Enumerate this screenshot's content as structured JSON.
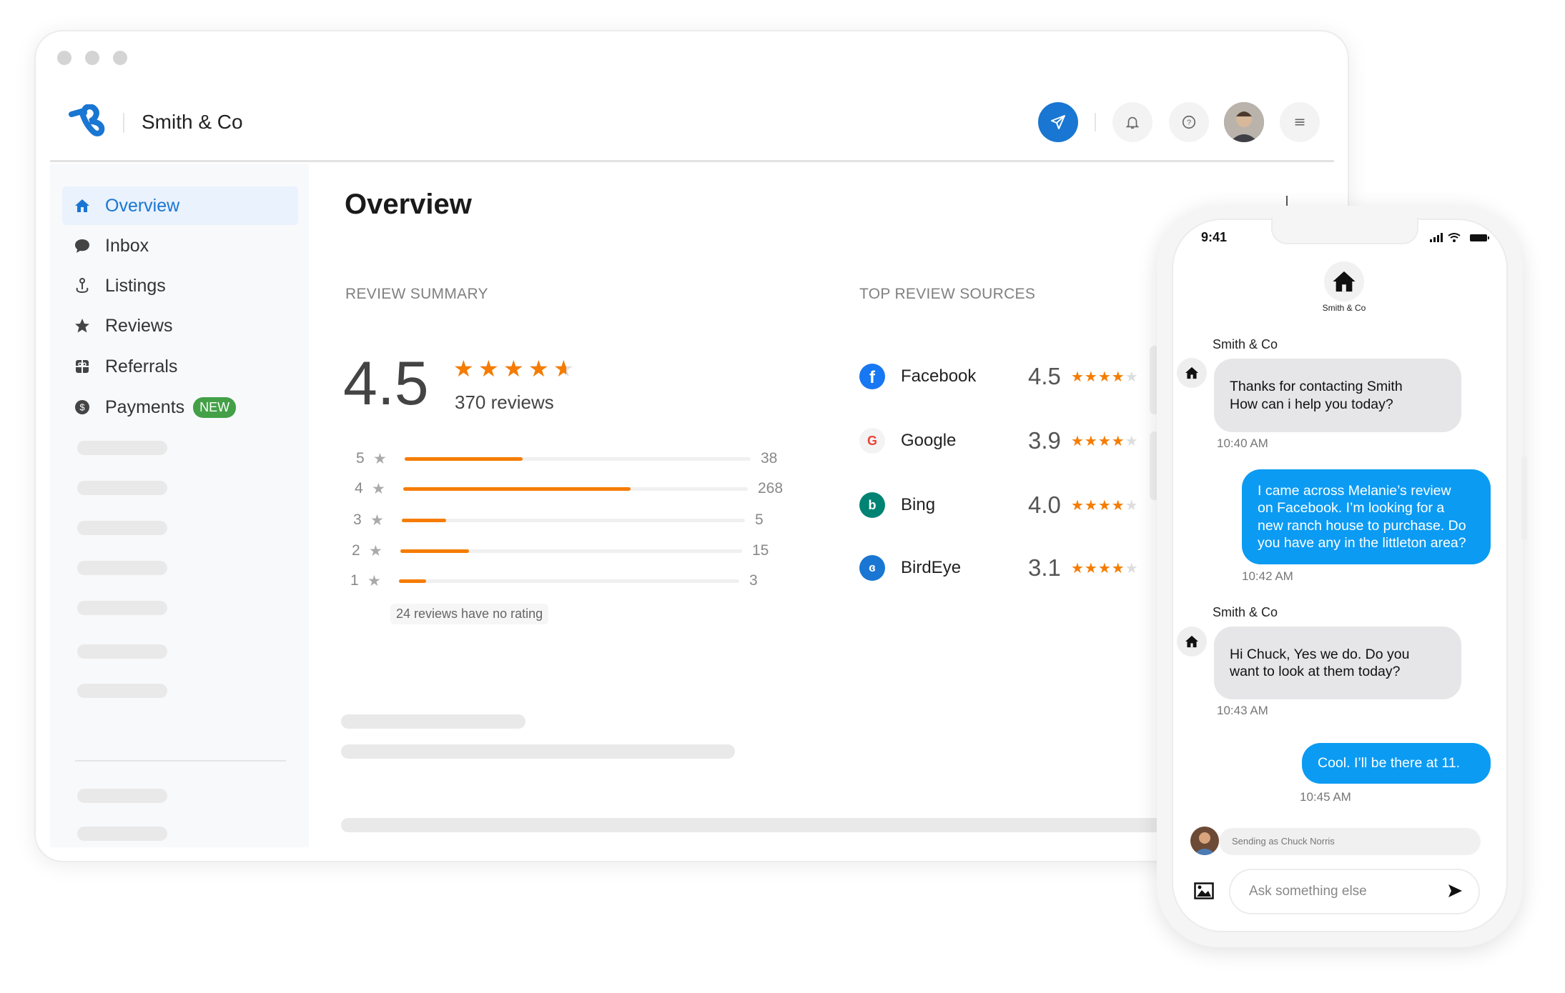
{
  "header": {
    "company": "Smith & Co",
    "icons": [
      "send-icon",
      "bell-icon",
      "help-icon",
      "avatar",
      "menu-icon"
    ]
  },
  "colors": {
    "brand": "#1976d2",
    "accent": "#f57c00",
    "chat_blue": "#0b9bf3",
    "new_badge": "#43a047"
  },
  "sidebar": {
    "items": [
      {
        "label": "Overview",
        "icon": "home-icon",
        "active": true
      },
      {
        "label": "Inbox",
        "icon": "chat-bubble-icon"
      },
      {
        "label": "Listings",
        "icon": "pin-icon"
      },
      {
        "label": "Reviews",
        "icon": "star-icon"
      },
      {
        "label": "Referrals",
        "icon": "gift-icon"
      },
      {
        "label": "Payments",
        "icon": "dollar-icon",
        "badge": "NEW"
      }
    ]
  },
  "main": {
    "title": "Overview",
    "review_summary": {
      "heading": "REVIEW SUMMARY",
      "average": "4.5",
      "stars": 4.5,
      "count_label": "370 reviews",
      "rows": [
        {
          "stars": "5",
          "count": "38",
          "fill": 0.34
        },
        {
          "stars": "4",
          "count": "268",
          "fill": 0.66
        },
        {
          "stars": "3",
          "count": "5",
          "fill": 0.13
        },
        {
          "stars": "2",
          "count": "15",
          "fill": 0.2
        },
        {
          "stars": "1",
          "count": "3",
          "fill": 0.08
        }
      ],
      "no_rating": "24 reviews have no rating"
    },
    "top_sources": {
      "heading": "TOP REVIEW SOURCES",
      "items": [
        {
          "name": "Facebook",
          "score": "4.5",
          "stars": 4,
          "icon": "facebook-icon"
        },
        {
          "name": "Google",
          "score": "3.9",
          "stars": 4,
          "icon": "google-icon"
        },
        {
          "name": "Bing",
          "score": "4.0",
          "stars": 4,
          "icon": "bing-icon"
        },
        {
          "name": "BirdEye",
          "score": "3.1",
          "stars": 4,
          "icon": "birdeye-icon"
        }
      ]
    }
  },
  "phone": {
    "time": "9:41",
    "business": "Smith & Co",
    "messages": [
      {
        "from": "Smith & Co",
        "lines": [
          "Thanks for contacting Smith",
          "How can i help you today?"
        ],
        "time": "10:40 AM"
      },
      {
        "from": "me",
        "lines": [
          "I came across Melanie’s review",
          "on Facebook. I’m looking for a",
          "new ranch house to purchase. Do",
          "you have any in the littleton area?"
        ],
        "time": "10:42 AM"
      },
      {
        "from": "Smith & Co",
        "lines": [
          "Hi Chuck, Yes we do. Do you",
          "want to look at them today?"
        ],
        "time": "10:43 AM"
      },
      {
        "from": "me",
        "lines": [
          "Cool. I’ll be there at 11."
        ],
        "time": "10:45 AM"
      }
    ],
    "sending_as": "Sending as Chuck Norris",
    "input_placeholder": "Ask something else"
  }
}
